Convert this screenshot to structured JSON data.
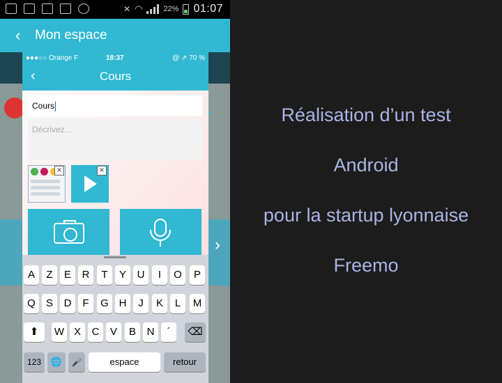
{
  "android": {
    "status": {
      "battery_pct": "22%",
      "time": "01:07"
    },
    "header": {
      "back_glyph": "‹",
      "title": "Mon espace"
    }
  },
  "iphone": {
    "status": {
      "carrier": "●●●○○ Orange F",
      "time": "18:37",
      "battery": "@ ⇗ 70 %"
    },
    "nav": {
      "back_glyph": "‹",
      "title": "Cours"
    },
    "title_value": "Cours",
    "description_placeholder": "Décrivez...",
    "close_glyph": "×",
    "keyboard": {
      "row1": [
        "A",
        "Z",
        "E",
        "R",
        "T",
        "Y",
        "U",
        "I",
        "O",
        "P"
      ],
      "row2": [
        "Q",
        "S",
        "D",
        "F",
        "G",
        "H",
        "J",
        "K",
        "L",
        "M"
      ],
      "row3": [
        "W",
        "X",
        "C",
        "V",
        "B",
        "N",
        "´"
      ],
      "shift_glyph": "⬆",
      "delete_glyph": "⌫",
      "numbers_label": "123",
      "globe_glyph": "🌐",
      "mic_glyph": "🎤",
      "space_label": "espace",
      "return_label": "retour"
    }
  },
  "caption": {
    "line1": "Réalisation d’un test",
    "line2": "Android",
    "line3": "pour la startup lyonnaise",
    "line4": "Freemo"
  },
  "colors": {
    "accent": "#31b8d2",
    "caption_text": "#a9b4e6",
    "panel_bg": "#1c1c1c"
  }
}
